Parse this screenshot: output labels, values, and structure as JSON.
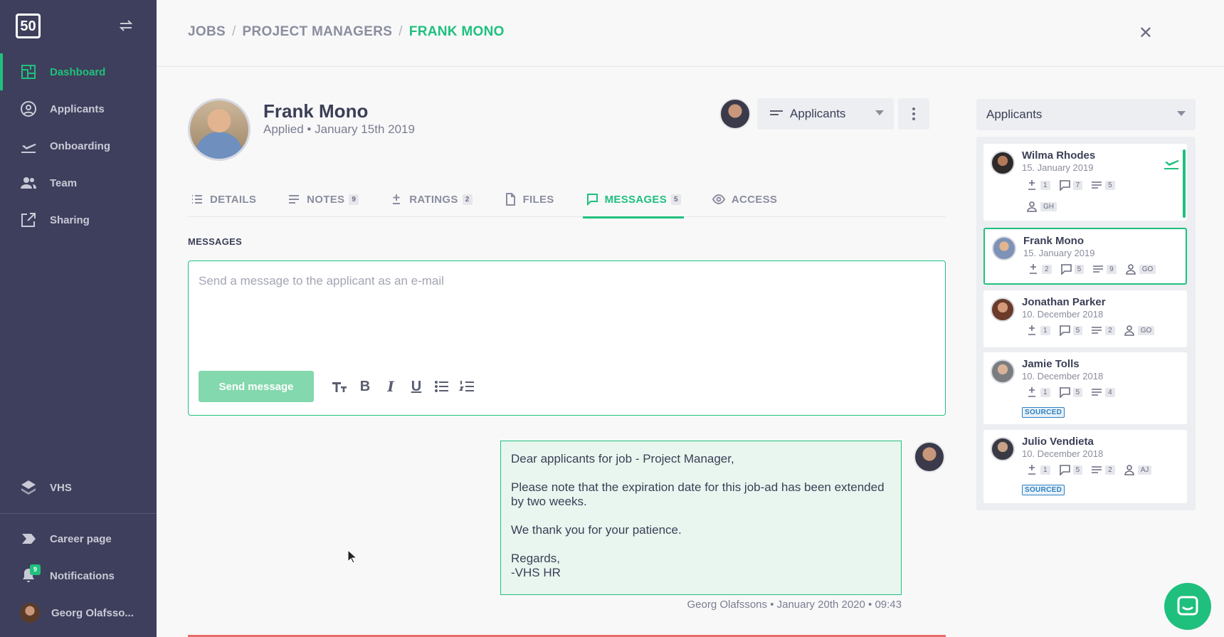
{
  "sidebar": {
    "logo": "50",
    "items": [
      {
        "label": "Dashboard",
        "icon": "dashboard-icon",
        "active": true
      },
      {
        "label": "Applicants",
        "icon": "user-circle-icon"
      },
      {
        "label": "Onboarding",
        "icon": "plane-icon"
      },
      {
        "label": "Team",
        "icon": "team-icon"
      },
      {
        "label": "Sharing",
        "icon": "share-icon"
      }
    ],
    "vhs": "VHS",
    "career_page": "Career page",
    "notifications": "Notifications",
    "notifications_badge": "9",
    "user": "Georg Olafsso..."
  },
  "breadcrumb": {
    "jobs": "JOBS",
    "pm": "PROJECT MANAGERS",
    "current": "FRANK MONO"
  },
  "profile": {
    "name": "Frank Mono",
    "sub": "Applied • January 15th 2019"
  },
  "stage_select": "Applicants",
  "tabs": [
    {
      "label": "DETAILS",
      "count": ""
    },
    {
      "label": "NOTES",
      "count": "9"
    },
    {
      "label": "RATINGS",
      "count": "2"
    },
    {
      "label": "FILES",
      "count": ""
    },
    {
      "label": "MESSAGES",
      "count": "5"
    },
    {
      "label": "ACCESS",
      "count": ""
    }
  ],
  "messages_label": "MESSAGES",
  "compose": {
    "placeholder": "Send a message to the applicant as an e-mail",
    "send": "Send message"
  },
  "message": {
    "p1": "Dear applicants for job - Project Manager,",
    "p2": "Please note that the expiration date for this job-ad has been extended by two weeks.",
    "p3": "We thank you for your patience.",
    "p4a": "Regards,",
    "p4b": "-VHS HR",
    "meta": "Georg Olafssons • January 20th 2020 • 09:43"
  },
  "right_panel": {
    "select": "Applicants",
    "cards": [
      {
        "name": "Wilma Rhodes",
        "date": "15. January 2019",
        "ratings": "1",
        "messages": "7",
        "notes": "5",
        "assignee": "GH"
      },
      {
        "name": "Frank Mono",
        "date": "15. January 2019",
        "ratings": "2",
        "messages": "5",
        "notes": "9",
        "assignee": "GO"
      },
      {
        "name": "Jonathan Parker",
        "date": "10. December 2018",
        "ratings": "1",
        "messages": "5",
        "notes": "2",
        "assignee": "GO"
      },
      {
        "name": "Jamie Tolls",
        "date": "10. December 2018",
        "ratings": "1",
        "messages": "5",
        "notes": "4",
        "tag": "SOURCED"
      },
      {
        "name": "Julio Vendieta",
        "date": "10. December 2018",
        "ratings": "1",
        "messages": "5",
        "notes": "2",
        "assignee": "AJ",
        "tag": "SOURCED"
      }
    ]
  },
  "colors": {
    "accent": "#1fc07d",
    "sidebar": "#3e3f5c",
    "sourced": "#2f7fbf"
  }
}
